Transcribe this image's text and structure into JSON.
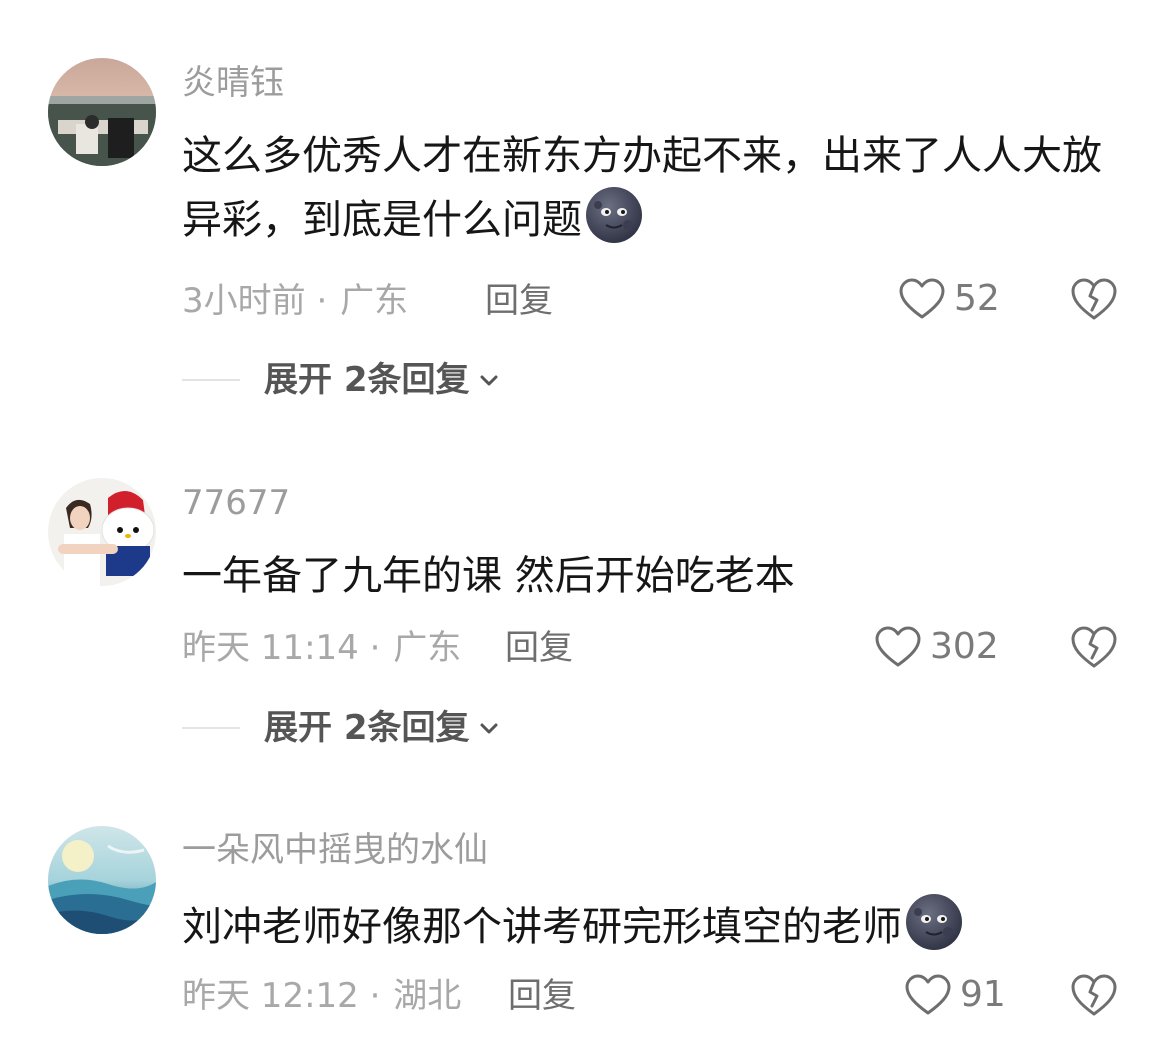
{
  "comments": [
    {
      "username": "炎晴钰",
      "text": "这么多优秀人才在新东方办起不来，出来了人人大放异彩，到底是什么问题",
      "emoji": "new-moon-face",
      "time": "3小时前",
      "separator": "·",
      "location": "广东",
      "reply_label": "回复",
      "likes": "52",
      "expand_label": "展开 2条回复"
    },
    {
      "username": "77677",
      "text": "一年备了九年的课 然后开始吃老本",
      "time": "昨天 11:14",
      "separator": "·",
      "location": "广东",
      "reply_label": "回复",
      "likes": "302",
      "expand_label": "展开 2条回复"
    },
    {
      "username": "一朵风中摇曳的水仙",
      "text": "刘冲老师好像那个讲考研完形填空的老师",
      "emoji": "new-moon-face",
      "time": "昨天 12:12",
      "separator": "·",
      "location": "湖北",
      "reply_label": "回复",
      "likes": "91"
    }
  ],
  "icons": {
    "like": "heart-outline-icon",
    "dislike": "broken-heart-icon",
    "expand": "chevron-down-icon"
  },
  "colors": {
    "text": "#161616",
    "muted": "#9c9c9c",
    "reply": "#6e6e6e",
    "expand": "#555555"
  }
}
